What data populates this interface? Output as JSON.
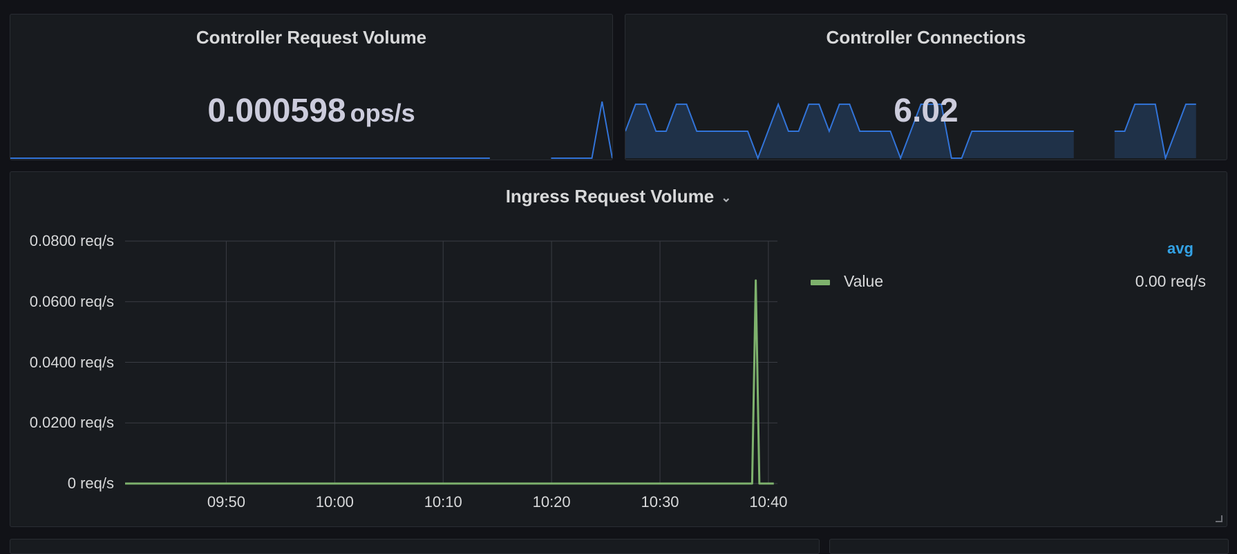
{
  "panels": {
    "request_volume": {
      "title": "Controller Request Volume",
      "value": "0.000598",
      "unit": "ops/s"
    },
    "connections": {
      "title": "Controller Connections",
      "value": "6.02"
    },
    "ingress": {
      "title": "Ingress Request Volume",
      "legend_header": "avg",
      "legend_name": "Value",
      "legend_value": "0.00 req/s"
    }
  },
  "colors": {
    "spark_line": "#3274d9",
    "spark_fill": "#1f3148",
    "series": "#7eb26d",
    "legend_header": "#33a2e5",
    "grid": "#3a3d44"
  },
  "chart_data": [
    {
      "type": "area",
      "name": "Controller Request Volume sparkline",
      "x": [
        0,
        1,
        2,
        3,
        4,
        5,
        6,
        7,
        8,
        9,
        10,
        11,
        12,
        13,
        14,
        15,
        16,
        17,
        18,
        19,
        20,
        21,
        22,
        23,
        24,
        25,
        26,
        27,
        28,
        29,
        30,
        31,
        32,
        33,
        34,
        35,
        36,
        37,
        38,
        39,
        40,
        41,
        42,
        43,
        44,
        45,
        46,
        47,
        48,
        49,
        50,
        51,
        52,
        53,
        54,
        55,
        56,
        57,
        58,
        59
      ],
      "values": [
        0,
        0,
        0,
        0,
        0,
        0,
        0,
        0,
        0,
        0,
        0,
        0,
        0,
        0,
        0,
        0,
        0,
        0,
        0,
        0,
        0,
        0,
        0,
        0,
        0,
        0,
        0,
        0,
        0,
        0,
        0,
        0,
        0,
        0,
        0,
        0,
        0,
        0,
        0,
        0,
        0,
        0,
        0,
        0,
        0,
        0,
        0,
        0,
        null,
        null,
        null,
        null,
        null,
        0,
        0,
        0,
        0,
        0,
        1,
        0
      ],
      "ylim": [
        0,
        1
      ]
    },
    {
      "type": "area",
      "name": "Controller Connections sparkline",
      "x": [
        0,
        1,
        2,
        3,
        4,
        5,
        6,
        7,
        8,
        9,
        10,
        11,
        12,
        13,
        14,
        15,
        16,
        17,
        18,
        19,
        20,
        21,
        22,
        23,
        24,
        25,
        26,
        27,
        28,
        29,
        30,
        31,
        32,
        33,
        34,
        35,
        36,
        37,
        38,
        39,
        40,
        41,
        42,
        43,
        44,
        45,
        46,
        47,
        48,
        49,
        50,
        51,
        52,
        53,
        54,
        55,
        56,
        57,
        58,
        59
      ],
      "values": [
        1,
        2,
        2,
        1,
        1,
        2,
        2,
        1,
        1,
        1,
        1,
        1,
        1,
        0,
        1,
        2,
        1,
        1,
        2,
        2,
        1,
        2,
        2,
        1,
        1,
        1,
        1,
        0,
        1,
        2,
        2,
        2,
        0,
        0,
        1,
        1,
        1,
        1,
        1,
        1,
        1,
        1,
        1,
        1,
        1,
        null,
        null,
        null,
        1,
        1,
        2,
        2,
        2,
        0,
        1,
        2,
        2,
        null,
        null,
        null
      ],
      "ylim": [
        0,
        2.1
      ]
    },
    {
      "type": "line",
      "title": "Ingress Request Volume",
      "series": [
        {
          "name": "Value",
          "x": [
            "09:40:40",
            "10:38:30",
            "10:38:50",
            "10:39:10",
            "10:39:30",
            "10:40:30"
          ],
          "values": [
            0,
            0,
            0.067,
            0,
            0,
            0
          ]
        }
      ],
      "xlim": [
        "09:40:40",
        "10:40:50"
      ],
      "xticks": [
        "09:50",
        "10:00",
        "10:10",
        "10:20",
        "10:30",
        "10:40"
      ],
      "ylim": [
        0,
        0.08
      ],
      "yticks": [
        "0 req/s",
        "0.0200 req/s",
        "0.0400 req/s",
        "0.0600 req/s",
        "0.0800 req/s"
      ],
      "grid": true,
      "legend": "right"
    }
  ]
}
